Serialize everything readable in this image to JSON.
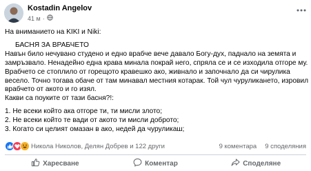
{
  "header": {
    "author": "Kostadin Angelov",
    "time": "41 м",
    "separator": "·"
  },
  "post": {
    "lines": [
      "На вниманието на KIKI и Niki:",
      "БАСНЯ ЗА ВРАБЧЕТО",
      "Навън било нечувано студено и едно врабче вече давало Богу-дух, паднало на земята  и",
      "замръзвало. Ненадейно една крава минала покрай него, спряла се и се изходила отгоре му.",
      "Врабчето се стоплило от горещото кравешко ако, живнало и започнало да си чирулика",
      "весело. Точно тогава обаче от там минавал местния котарак. Той чул чуруликането, изровил",
      "врабчето от акото и го изял.",
      "Какви са поуките от тази басня?!:",
      "1. Не всеки който ака отгоре ти, ти мисли злото;",
      "2. Не всеки който те вади от акото ти мисли доброто;",
      "3. Когато си целият омазан в ако, недей да чуруликаш;"
    ]
  },
  "reactions": {
    "names": "Никола Николов, Делян Добрев и 122 други",
    "comments": "9 коментара",
    "shares": "9 споделяния"
  },
  "actions": {
    "like": "Харесване",
    "comment": "Коментар",
    "share": "Споделяне"
  },
  "colors": {
    "like_blue": "#1877f2",
    "love_red": "#f33e58",
    "haha_yellow": "#f7b125",
    "secondary_text": "#65676b"
  }
}
